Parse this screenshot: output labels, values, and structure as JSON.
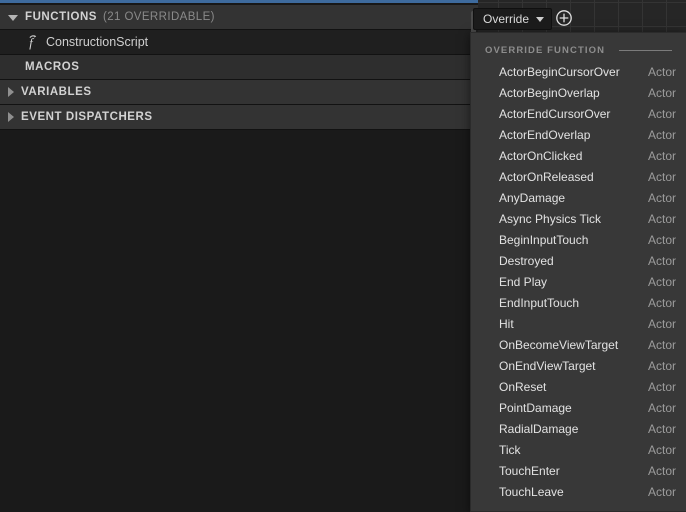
{
  "theme": {
    "accent": "#3e6b9e",
    "panel_bg": "#1a1a1a",
    "header_bg": "#333333",
    "menu_bg": "#383838",
    "text": "#d2d2d2",
    "muted_text": "#8a8a8a"
  },
  "panel": {
    "sections": [
      {
        "name": "functions",
        "title": "FUNCTIONS",
        "count": "(21 OVERRIDABLE)",
        "expander": "open"
      },
      {
        "name": "macros",
        "title": "MACROS",
        "count": "",
        "expander": "none"
      },
      {
        "name": "variables",
        "title": "VARIABLES",
        "count": "",
        "expander": "closed"
      },
      {
        "name": "event-dispatchers",
        "title": "EVENT DISPATCHERS",
        "count": "",
        "expander": "closed"
      }
    ],
    "function_item": {
      "label": "ConstructionScript",
      "icon": "function-icon"
    }
  },
  "toolbar": {
    "override_label": "Override",
    "override_icon": "chevron-down-icon",
    "add_icon": "plus-circle-icon"
  },
  "menu": {
    "section_label": "OVERRIDE FUNCTION",
    "items": [
      {
        "name": "ActorBeginCursorOver",
        "category": "Actor"
      },
      {
        "name": "ActorBeginOverlap",
        "category": "Actor"
      },
      {
        "name": "ActorEndCursorOver",
        "category": "Actor"
      },
      {
        "name": "ActorEndOverlap",
        "category": "Actor"
      },
      {
        "name": "ActorOnClicked",
        "category": "Actor"
      },
      {
        "name": "ActorOnReleased",
        "category": "Actor"
      },
      {
        "name": "AnyDamage",
        "category": "Actor"
      },
      {
        "name": "Async Physics Tick",
        "category": "Actor"
      },
      {
        "name": "BeginInputTouch",
        "category": "Actor"
      },
      {
        "name": "Destroyed",
        "category": "Actor"
      },
      {
        "name": "End Play",
        "category": "Actor"
      },
      {
        "name": "EndInputTouch",
        "category": "Actor"
      },
      {
        "name": "Hit",
        "category": "Actor"
      },
      {
        "name": "OnBecomeViewTarget",
        "category": "Actor"
      },
      {
        "name": "OnEndViewTarget",
        "category": "Actor"
      },
      {
        "name": "OnReset",
        "category": "Actor"
      },
      {
        "name": "PointDamage",
        "category": "Actor"
      },
      {
        "name": "RadialDamage",
        "category": "Actor"
      },
      {
        "name": "Tick",
        "category": "Actor"
      },
      {
        "name": "TouchEnter",
        "category": "Actor"
      },
      {
        "name": "TouchLeave",
        "category": "Actor"
      }
    ]
  }
}
